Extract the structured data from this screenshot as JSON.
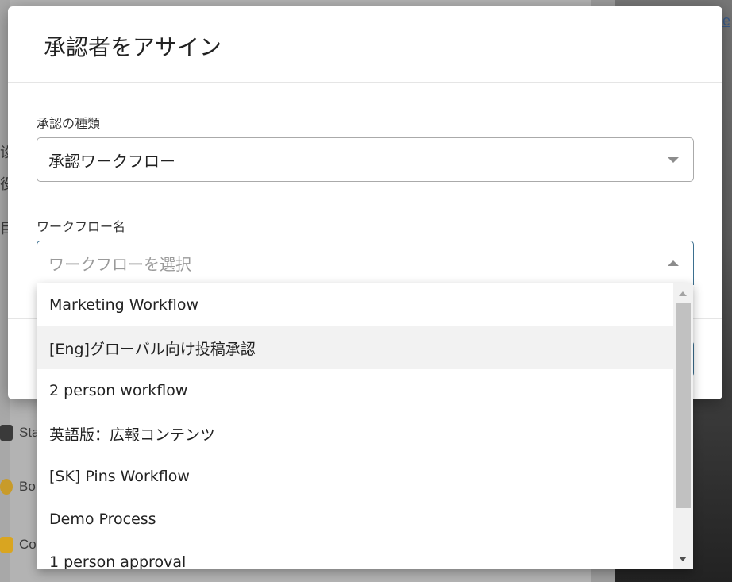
{
  "background": {
    "link_fragment": "fe",
    "side_items": [
      {
        "label": "Sta",
        "icon": "badge-icon",
        "color": "#3a3a3a"
      },
      {
        "label": "Bo",
        "icon": "coin-icon",
        "color": "#c89b2a"
      },
      {
        "label": "Co",
        "icon": "folder-icon",
        "color": "#d9a520"
      }
    ],
    "text_snippets": [
      "设",
      "役",
      "目"
    ]
  },
  "modal": {
    "title": "承認者をアサイン",
    "approval_type": {
      "label": "承認の種類",
      "value": "承認ワークフロー"
    },
    "workflow_name": {
      "label": "ワークフロー名",
      "placeholder": "ワークフローを選択"
    }
  },
  "dropdown": {
    "options": [
      {
        "label": "Marketing Workflow",
        "highlighted": false
      },
      {
        "label": "[Eng]グローバル向け投稿承認",
        "highlighted": true
      },
      {
        "label": "2 person workflow",
        "highlighted": false
      },
      {
        "label": "英語版：広報コンテンツ",
        "highlighted": false
      },
      {
        "label": "[SK] Pins Workflow",
        "highlighted": false
      },
      {
        "label": "Demo Process",
        "highlighted": false
      },
      {
        "label": "1 person approval",
        "highlighted": false
      }
    ]
  },
  "colors": {
    "accent": "#3b6f8f",
    "highlight": "#f2f2f2"
  }
}
